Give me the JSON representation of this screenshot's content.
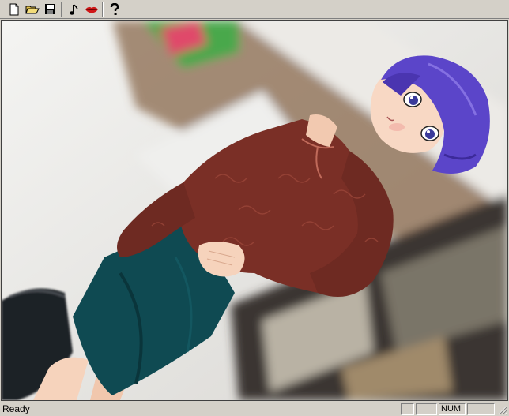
{
  "toolbar": {
    "buttons": [
      {
        "name": "new-file-icon"
      },
      {
        "name": "open-folder-icon"
      },
      {
        "name": "save-disk-icon"
      },
      {
        "name": "music-note-icon"
      },
      {
        "name": "lips-icon"
      },
      {
        "name": "help-question-icon"
      }
    ]
  },
  "statusbar": {
    "text": "Ready",
    "panes": [
      "",
      "",
      "NUM",
      ""
    ]
  },
  "colors": {
    "window_bg": "#d4d0c8",
    "hair": "#5b45c9",
    "blouse": "#7a2f26",
    "skirt": "#0f4a52"
  }
}
